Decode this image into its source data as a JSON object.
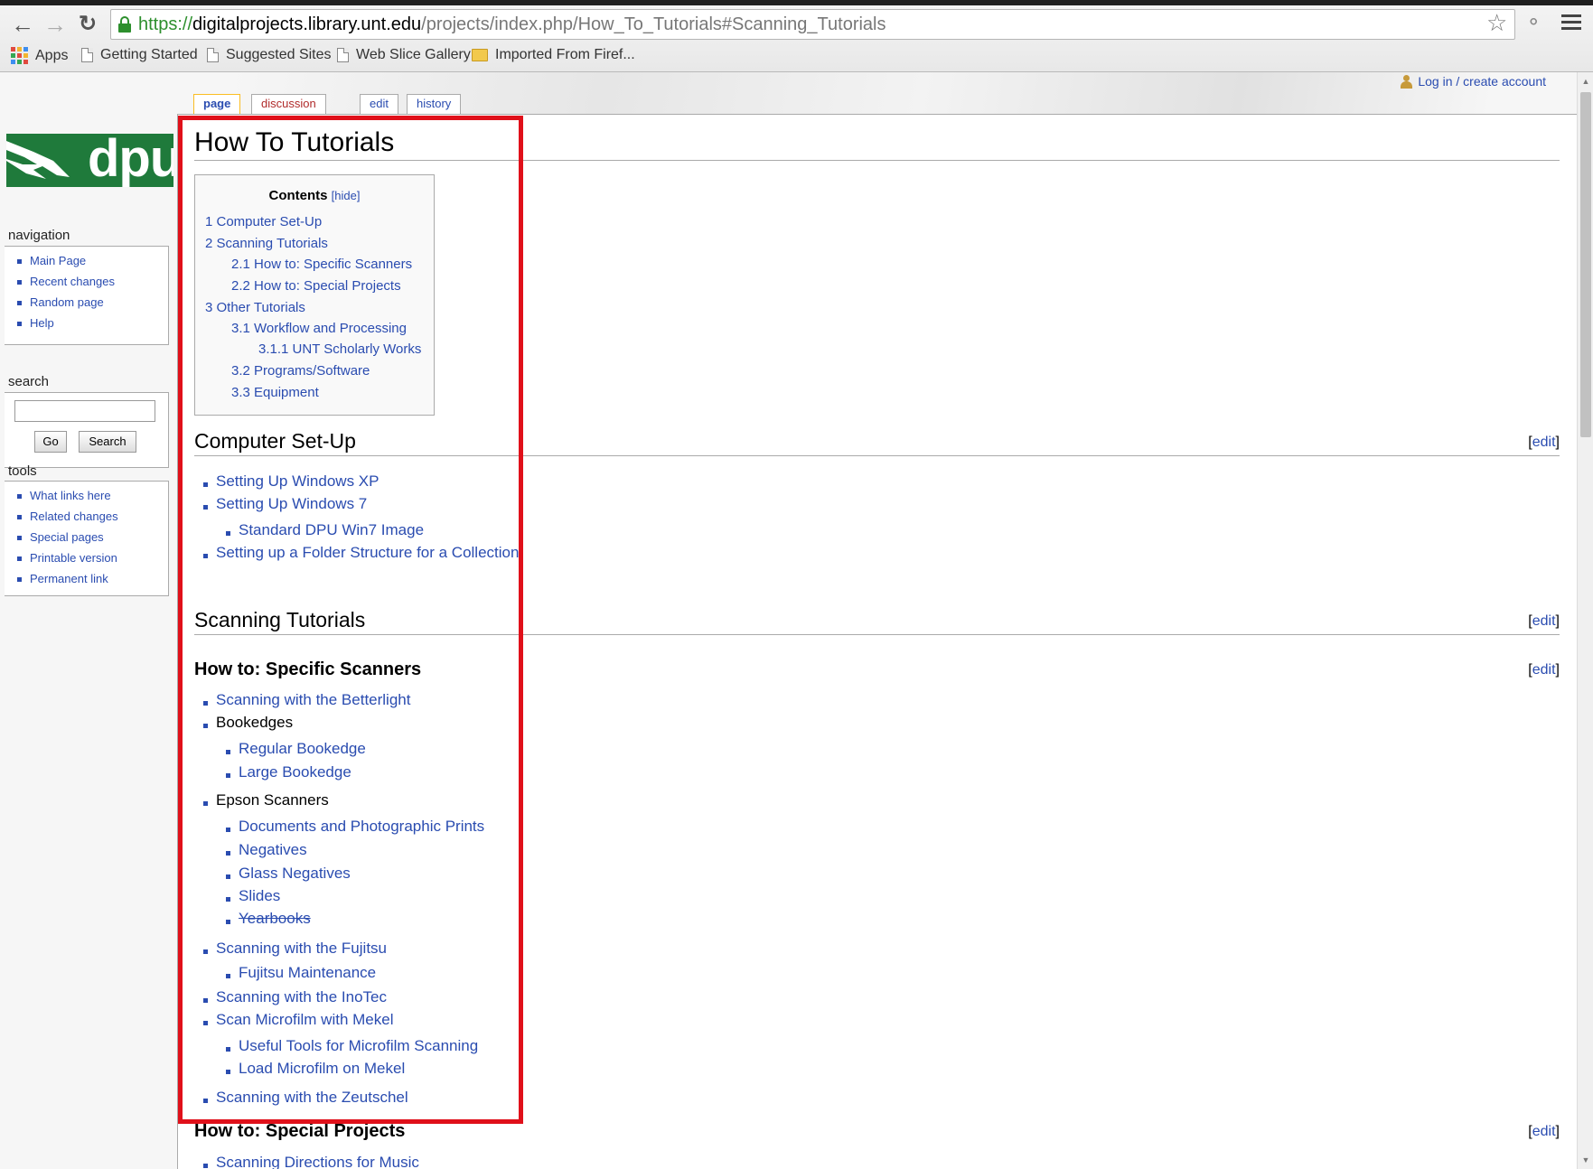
{
  "browser": {
    "url_scheme": "https://",
    "url_host": "digitalprojects.library.unt.edu",
    "url_path": "/projects/index.php/How_To_Tutorials#Scanning_Tutorials",
    "bookmarks": [
      "Apps",
      "Getting Started",
      "Suggested Sites",
      "Web Slice Gallery",
      "Imported From Firef..."
    ],
    "icons": [
      "back-arrow-icon",
      "forward-arrow-icon",
      "reload-icon",
      "lock-icon",
      "star-icon",
      "extension-icon",
      "menu-icon"
    ]
  },
  "personal": {
    "login": "Log in / create account"
  },
  "tabs": [
    "page",
    "discussion",
    "edit",
    "history"
  ],
  "logo_text": "dpu",
  "sidebar": {
    "navigation": {
      "title": "navigation",
      "items": [
        "Main Page",
        "Recent changes",
        "Random page",
        "Help"
      ]
    },
    "search": {
      "title": "search",
      "go": "Go",
      "search": "Search",
      "value": ""
    },
    "tools": {
      "title": "tools",
      "items": [
        "What links here",
        "Related changes",
        "Special pages",
        "Printable version",
        "Permanent link"
      ]
    }
  },
  "page": {
    "title": "How To Tutorials",
    "toc": {
      "title": "Contents",
      "hide": "[hide]",
      "items": [
        "1 Computer Set-Up",
        "2 Scanning Tutorials",
        "2.1 How to: Specific Scanners",
        "2.2 How to: Special Projects",
        "3 Other Tutorials",
        "3.1 Workflow and Processing",
        "3.1.1 UNT Scholarly Works",
        "3.2 Programs/Software",
        "3.3 Equipment"
      ]
    },
    "edit_label": "edit",
    "computer_setup": {
      "heading": "Computer Set-Up",
      "items": [
        "Setting Up Windows XP",
        "Setting Up Windows 7",
        "Standard DPU Win7 Image",
        "Setting up a Folder Structure for a Collection"
      ]
    },
    "scanning": {
      "heading": "Scanning Tutorials",
      "specific_heading": "How to: Specific Scanners",
      "items": [
        "Scanning with the Betterlight",
        "Bookedges",
        "Regular Bookedge",
        "Large Bookedge",
        "Epson Scanners",
        "Documents and Photographic Prints",
        "Negatives",
        "Glass Negatives",
        "Slides",
        "Yearbooks",
        "Scanning with the Fujitsu",
        "Fujitsu Maintenance",
        "Scanning with the InoTec",
        "Scan Microfilm with Mekel",
        "Useful Tools for Microfilm Scanning",
        "Load Microfilm on Mekel",
        "Scanning with the Zeutschel"
      ],
      "special_heading": "How to: Special Projects",
      "special_items": [
        "Scanning Directions for Music"
      ]
    }
  },
  "colors": {
    "link": "#2a4cb0",
    "highlight": "#e0101a",
    "logo_green": "#1f7a3b"
  }
}
